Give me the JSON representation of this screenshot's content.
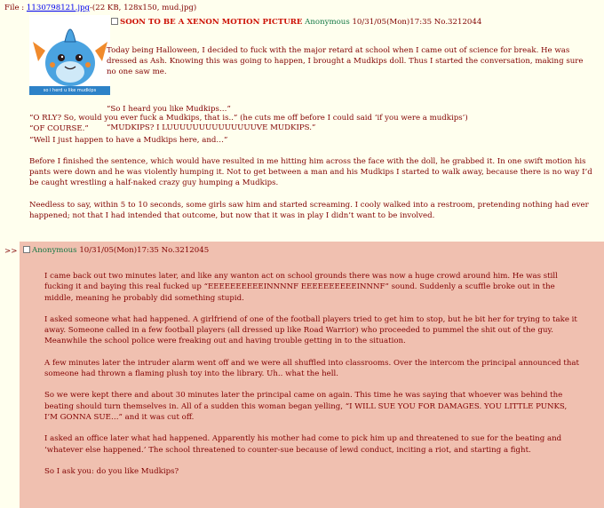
{
  "file": {
    "prefix": "File :",
    "name": "1130798121.jpg",
    "meta": "-(22 KB, 128x150, mud.jpg)"
  },
  "thumbnail": {
    "caption": "so i herd u like mudkips"
  },
  "op": {
    "subject": "SOON TO BE A XENON MOTION PICTURE",
    "name": "Anonymous",
    "date": "10/31/05(Mon)17:35",
    "number": "No.3212044",
    "paragraphs_beside_image": [
      "Today being Halloween, I decided to fuck with the major retard at school when I came out of science for break. He was dressed as Ash. Knowing this was going to happen, I brought a Mudkips doll. Thus I started the conversation, making sure no one saw me.",
      "",
      "“So I heard you like Mudkips…”",
      "“MUDKIPS? I LUUUUUUUUUUUUUUVE MUDKIPS.”"
    ],
    "paragraphs_below_image": [
      "“O RLY? So, would you ever fuck a Mudkips, that is..” (he cuts me off before I could said ‘if you were a mudkips’)",
      "“OF COURSE.”",
      "“Well I just happen to have a Mudkips here, and…”",
      "",
      "Before I finished the sentence, which would have resulted in me hitting him across the face with the doll, he grabbed it. In one swift motion his pants were down and he was violently humping it. Not to get between a man and his Mudkips I started to walk away, because there is no way I’d be caught wrestling a half-naked crazy guy humping a Mudkips.",
      "",
      "Needless to say, within 5 to 10 seconds, some girls saw him and started screaming. I cooly walked into a restroom, pretending nothing had ever happened; not that I had intended that outcome, but now that it was in play I didn’t want to be involved."
    ]
  },
  "reply": {
    "arrow": ">>",
    "name": "Anonymous",
    "date": "10/31/05(Mon)17:35",
    "number": "No.3212045",
    "paragraphs": [
      "I came back out two minutes later, and like any wanton act on school grounds there was now a huge crowd around him. He was still fucking it and baying this real fucked up “EEEEEEEEEEINNNNF EEEEEEEEEEINNNF” sound. Suddenly a scuffle broke out in the middle, meaning he probably did something stupid.",
      "",
      "I asked someone what had happened. A girlfriend of one of the football players tried to get him to stop, but he bit her for trying to take it away. Someone called in a few football players (all dressed up like Road Warrior) who proceeded to pummel the shit out of the guy. Meanwhile the school police were freaking out and having trouble getting in to the situation.",
      "",
      "A few minutes later the intruder alarm went off and we were all shuffled into classrooms. Over the intercom the principal announced that someone had thrown a flaming plush toy into the library. Uh.. what the hell.",
      "",
      "So we were kept there and about 30 minutes later the principal came on again. This time he was saying that whoever was behind the beating should turn themselves in. All of a sudden this woman began yelling, “I WILL SUE YOU FOR DAMAGES. YOU LITTLE PUNKS, I’M GONNA SUE…” and it was cut off.",
      "",
      "I asked an office later what had happened. Apparently his mother had come to pick him up and threatened to sue for the beating and ‘whatever else happened.’ The school threatened to counter-sue because of lewd conduct, inciting a riot, and starting a fight.",
      "",
      "So I ask you: do you like Mudkips?"
    ]
  }
}
